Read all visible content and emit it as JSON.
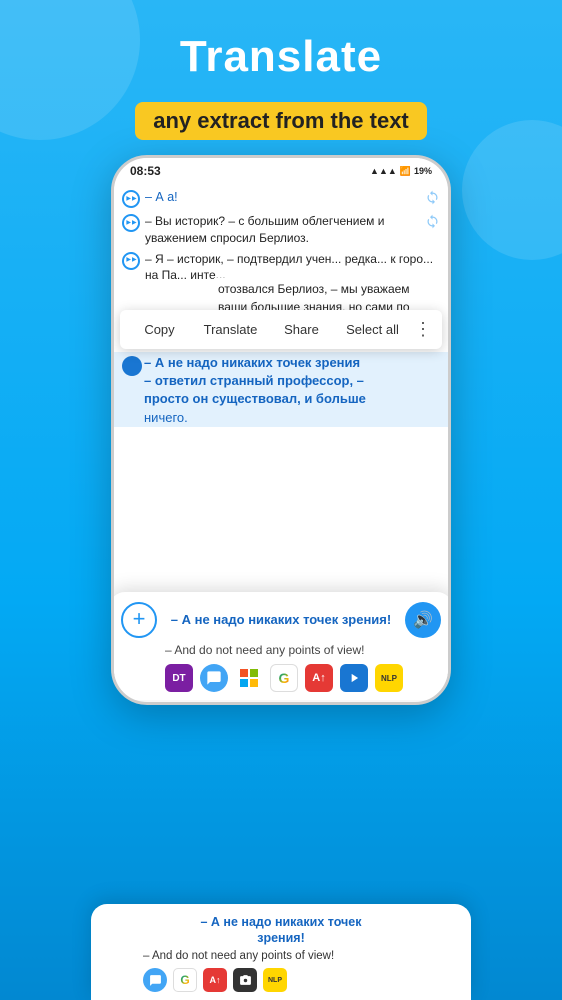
{
  "header": {
    "title": "Translate",
    "subtitle": "any extract from the text"
  },
  "statusBar": {
    "time": "08:53",
    "battery": "19%",
    "signal": "▲▲▲"
  },
  "readerLines": [
    {
      "id": 1,
      "text": "– А а!",
      "hasPlay": true,
      "hasSync": true
    },
    {
      "id": 2,
      "text": "– Вы историк? – с большим облегчением и уважением спросил Берлиоз.",
      "hasPlay": true,
      "hasSync": true
    },
    {
      "id": 3,
      "text": "– Я – историк, – подтвердил учен... к гор... на Па... инте...",
      "hasPlay": true,
      "hasSync": false
    }
  ],
  "bgText": {
    "line1": "отозвался Берлиоз, – мы уважаем",
    "line2": "ваши большие знания, но сами по"
  },
  "contextMenu": {
    "copy": "Copy",
    "translate": "Translate",
    "share": "Share",
    "selectAll": "Select all"
  },
  "selectedLines": [
    "– А не надо никаких точек зрения",
    "– ответил странный профессор, –",
    "просто он существовал, и больше",
    "ничего."
  ],
  "translationPanel": {
    "sourceText": "– А не надо никаких точек зрения!",
    "targetText": "– And do not need any points of view!",
    "addLabel": "+",
    "audioLabel": "🔊"
  },
  "appIcons": [
    {
      "id": "dt",
      "label": "DT",
      "type": "dt"
    },
    {
      "id": "bubble",
      "label": "●",
      "type": "bubble"
    },
    {
      "id": "ms",
      "label": "ms",
      "type": "ms"
    },
    {
      "id": "google",
      "label": "G",
      "type": "google"
    },
    {
      "id": "reverso",
      "label": "A↑",
      "type": "reverso"
    },
    {
      "id": "prompt",
      "label": "▶",
      "type": "prompt"
    },
    {
      "id": "nlp",
      "label": "NLP",
      "type": "nlp"
    }
  ],
  "bottomPreview": {
    "line1": "– А не надо никаких точек",
    "line2": "зрения!",
    "translation": "– And do not need any points of view!"
  }
}
